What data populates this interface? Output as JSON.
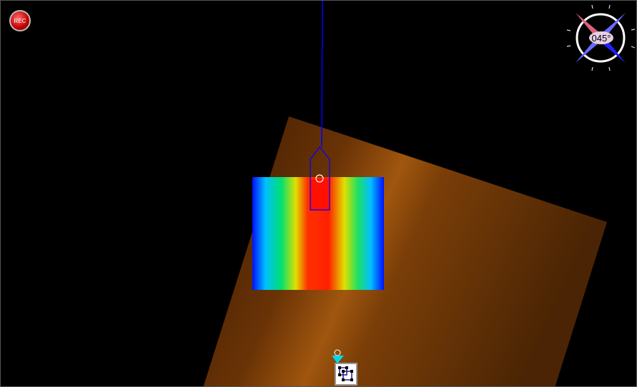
{
  "record_button": {
    "label": "REC"
  },
  "compass": {
    "heading_text": "045°",
    "heading_deg": 45
  },
  "colors": {
    "sonar": "#a85a10",
    "boat": "#0000ff",
    "marker": "#00d8e8"
  },
  "tool_button": {
    "icon": "selection-tool-icon"
  }
}
